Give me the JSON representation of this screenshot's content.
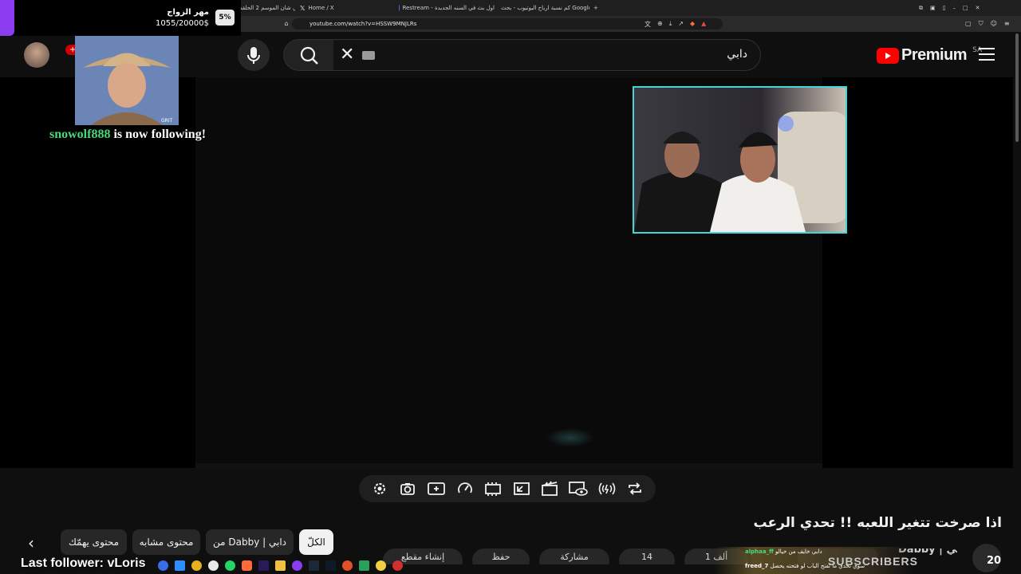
{
  "browser": {
    "tabs": [
      {
        "label": "جاكي شان الموسم 2 الحلقه"
      },
      {
        "label": "Home / X"
      },
      {
        "label": "Restream - اول بث في السنه الجديدة"
      },
      {
        "label": "كم نسبة ارباح اليوتيوب - بحث Google"
      }
    ],
    "new_tab": "+",
    "url": "youtube.com/watch?v=HSSW9MNJLRs",
    "window_controls": [
      "–",
      "□",
      "✕"
    ]
  },
  "youtube": {
    "brand": "Premium",
    "region": "SA",
    "search_value": "دابي",
    "notification_count": "+9",
    "menu_icon": "hamburger-icon"
  },
  "stream_overlay": {
    "goal_title": "مهر الزواج",
    "goal_progress": "1055/20000$",
    "goal_percent": "5%",
    "goal_fraction": 0.05,
    "follower_name": "snowolf888",
    "follower_text": " is now following!",
    "last_follower_label": "Last follower: vLoris",
    "sub_label": "SUBSCRIBERS",
    "sub_count": "20",
    "chat": [
      {
        "user": "alphaa_ff",
        "text": "دابي خايف من خيالو"
      },
      {
        "user": "freed_7",
        "text": "سوي تحدي ما تفتح الباب لو فتحته يحصل"
      }
    ]
  },
  "video": {
    "title": "اذا صرخت تتغير اللعبه !! تحدي الرعب",
    "channel": "Dabby | دابي"
  },
  "chips": [
    {
      "label": "الكلّ"
    },
    {
      "label": "من Dabby | دابي"
    },
    {
      "label": "محتوى مشابه"
    },
    {
      "label": "محتوى يهمّك"
    }
  ],
  "actions": {
    "likes": "1 ألف",
    "comments": "14",
    "share": "مشاركة",
    "save": "حفظ",
    "clip": "إنشاء مقطع"
  },
  "colors": {
    "accent_teal": "#42d6d8",
    "youtube_red": "#ff0000",
    "follower_green": "#4ad97a",
    "goal_purple": "#8b3cf0"
  }
}
